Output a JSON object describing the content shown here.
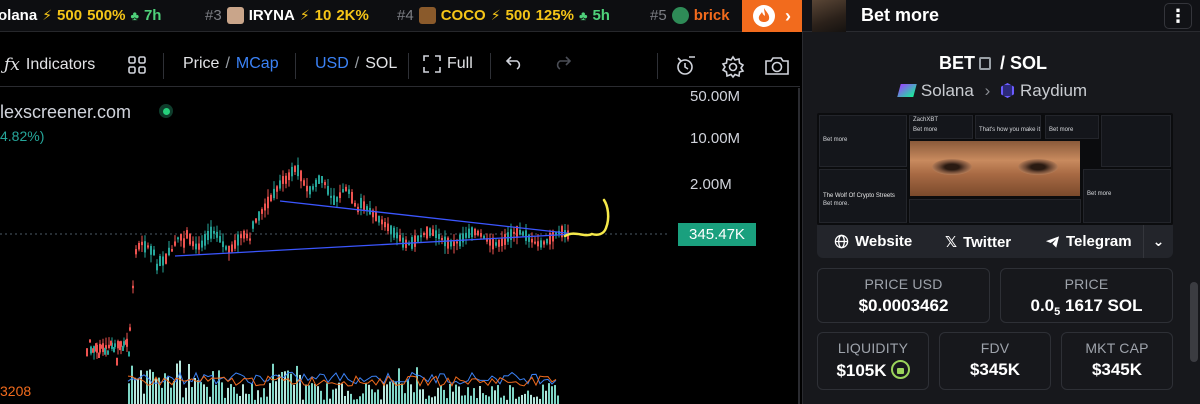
{
  "ticker": [
    {
      "rank": "",
      "name": "olana",
      "boost": "500",
      "pct": "500%",
      "age": "7h"
    },
    {
      "rank": "#3",
      "name": "IRYNA",
      "boost": "10",
      "pct": "2K%",
      "age": ""
    },
    {
      "rank": "#4",
      "name": "COCO",
      "boost": "500",
      "pct": "125%",
      "age": "5h"
    },
    {
      "rank": "#5",
      "name": "brick",
      "boost": "",
      "pct": "",
      "age": ""
    }
  ],
  "header": {
    "title": "Bet more"
  },
  "toolbar": {
    "fx_label": "Indicators",
    "price": "Price",
    "slash": "/",
    "mcap": "MCap",
    "usd": "USD",
    "sol": "SOL",
    "full": "Full"
  },
  "chart": {
    "watermark": "lexscreener.com",
    "change_label": "4.82%)",
    "y_labels": [
      "50.00M",
      "10.00M",
      "2.00M"
    ],
    "current_price": "345.47K",
    "volume_label": "3208"
  },
  "colors": {
    "up": "#26a69a",
    "down": "#ef5350",
    "accent": "#f26b1d",
    "trendline": "#3b56ff",
    "drawing": "#f5e94a"
  },
  "token": {
    "symbol": "BET",
    "quote": "SOL",
    "chain": "Solana",
    "dex": "Raydium"
  },
  "banner": {
    "tweets": [
      "Bet more",
      "Bet more",
      "Bet more",
      "The Wolf Of Crypto Streets",
      "Bet more.",
      "ZachXBT",
      "That's how you make it",
      "Bet more"
    ]
  },
  "links": {
    "website": "Website",
    "twitter": "Twitter",
    "telegram": "Telegram"
  },
  "stats": {
    "price_usd_label": "PRICE USD",
    "price_usd": "$0.0003462",
    "price_label": "PRICE",
    "price_sol_a": "0.0",
    "price_sol_sub": "5",
    "price_sol_b": "1617 SOL",
    "liquidity_label": "LIQUIDITY",
    "liquidity": "$105K",
    "fdv_label": "FDV",
    "fdv": "$345K",
    "mcap_label": "MKT CAP",
    "mcap": "$345K"
  }
}
